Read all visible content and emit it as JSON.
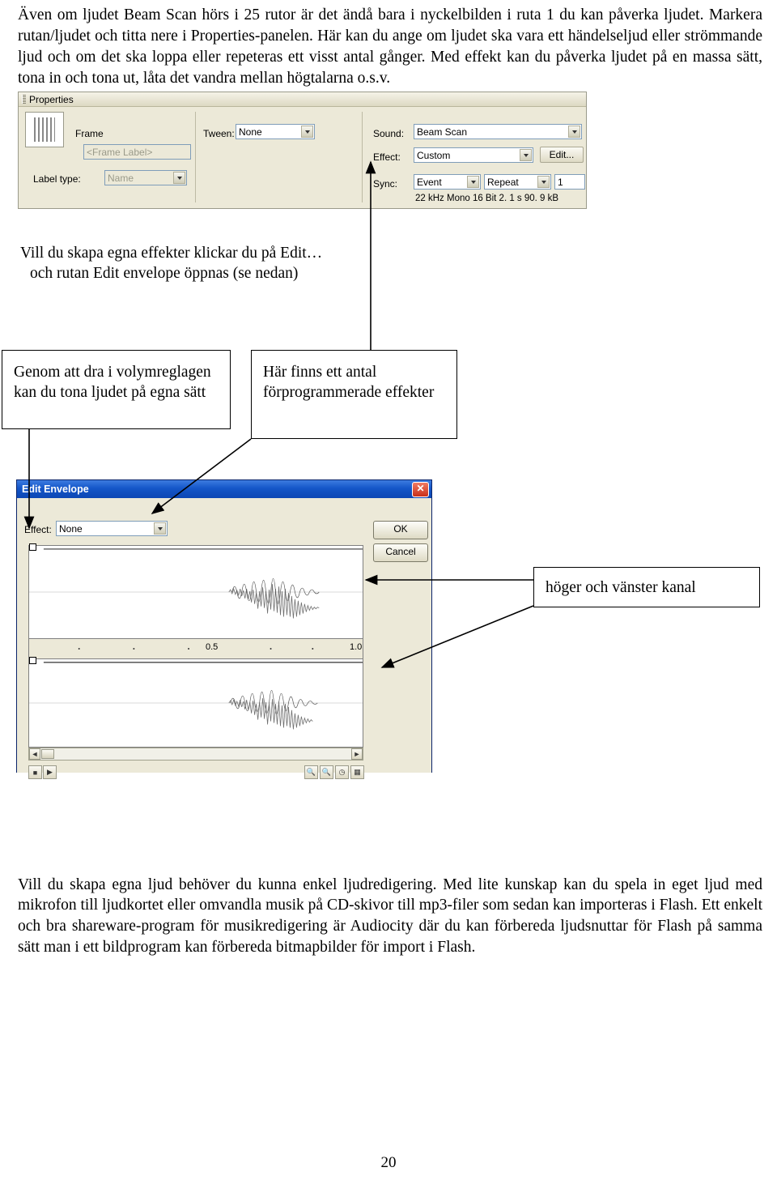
{
  "document": {
    "intro_paragraph": "Även om ljudet Beam Scan hörs i 25 rutor är det ändå bara i nyckelbilden i ruta 1 du kan påverka ljudet. Markera rutan/ljudet och titta nere i Properties-panelen. Här kan du ange om ljudet ska vara ett händelseljud eller strömmande ljud och om det ska loppa eller repeteras ett visst antal gånger. Med effekt kan du påverka ljudet på en massa sätt, tona in och tona ut, låta det vandra mellan högtalarna o.s.v.",
    "closing_paragraph": "Vill du skapa egna ljud behöver du kunna enkel ljudredigering. Med lite kunskap kan du spela in eget ljud med mikrofon till ljudkortet eller omvandla musik på CD-skivor till mp3-filer som sedan kan importeras i Flash. Ett enkelt och bra shareware-program för musikredigering är Audiocity där du kan förbereda ljudsnuttar för Flash på samma sätt man i ett bildprogram kan förbereda bitmapbilder för import i Flash.",
    "page_number": "20"
  },
  "properties_panel": {
    "title": "Properties",
    "frame_label": "Frame",
    "frame_label_field": "<Frame Label>",
    "label_type_label": "Label type:",
    "label_type_value": "Name",
    "tween_label": "Tween:",
    "tween_value": "None",
    "sound_label": "Sound:",
    "sound_value": "Beam Scan",
    "effect_label": "Effect:",
    "effect_value": "Custom",
    "edit_button": "Edit...",
    "sync_label": "Sync:",
    "sync_value": "Event",
    "repeat_value": "Repeat",
    "repeat_count": "1",
    "audio_info": "22 kHz Mono 16 Bit 2. 1 s 90. 9 kB"
  },
  "annotations": {
    "edit_note_line1": "Vill du skapa egna effekter klickar du på Edit…",
    "edit_note_line2": "och rutan Edit envelope öppnas (se nedan)",
    "volume_box": "Genom att dra i volymreglagen kan du tona ljudet på egna sätt",
    "presets_box": "Här finns ett antal förprogrammerade effekter",
    "channels_box": "höger och vänster kanal"
  },
  "edit_envelope": {
    "title": "Edit Envelope",
    "effect_label": "Effect:",
    "effect_value": "None",
    "ok_button": "OK",
    "cancel_button": "Cancel",
    "ruler_mid": "0.5",
    "ruler_right": "1.0",
    "icons": {
      "close": "close-icon",
      "zoom_in": "zoom-in-icon",
      "zoom_out": "zoom-out-icon",
      "seconds": "seconds-icon",
      "frames": "frames-icon",
      "stop": "stop-icon",
      "play": "play-icon",
      "scroll_left": "scroll-left-icon",
      "scroll_right": "scroll-right-icon"
    }
  }
}
